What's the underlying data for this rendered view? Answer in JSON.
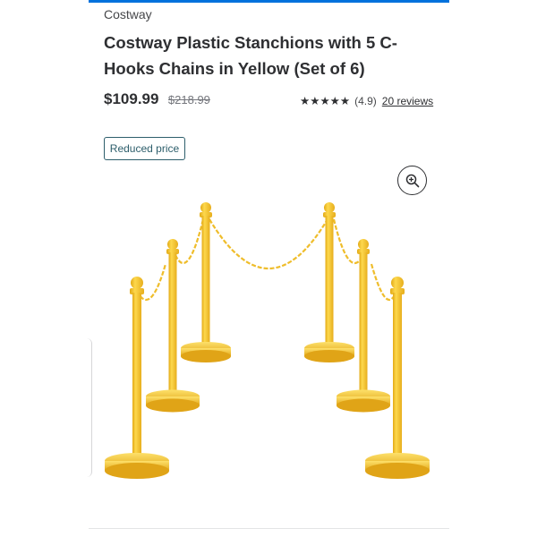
{
  "header": {
    "accent_color": "#0071dc"
  },
  "product": {
    "brand": "Costway",
    "title": "Costway Plastic Stanchions with 5 C-Hooks Chains in Yellow (Set of 6)",
    "price_current": "$109.99",
    "price_was": "$218.99",
    "rating_stars": 5,
    "rating_value": "(4.9)",
    "reviews_link": "20 reviews",
    "badge": "Reduced price"
  },
  "gallery": {
    "zoom_icon": "zoom-in-icon",
    "image_subject": "yellow-stanchions",
    "post_color": "#f7c531"
  }
}
